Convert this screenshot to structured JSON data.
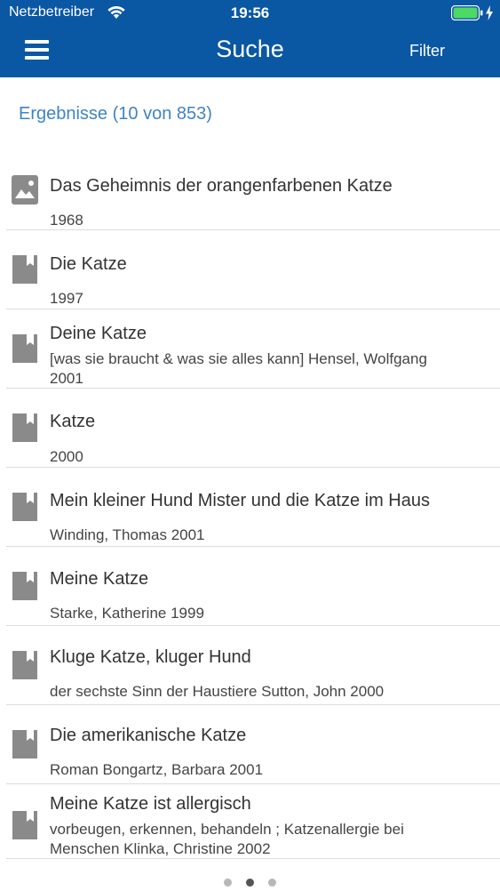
{
  "status": {
    "carrier": "Netzbetreiber",
    "time": "19:56"
  },
  "nav": {
    "title": "Suche",
    "filter_label": "Filter"
  },
  "results_count": "Ergebnisse (10 von 853)",
  "results": [
    {
      "type": "image-icon",
      "title": "Das Geheimnis der orangenfarbenen Katze",
      "sub": "1968"
    },
    {
      "type": "book-icon",
      "title": "Die Katze",
      "sub": "1997"
    },
    {
      "type": "book-icon",
      "title": "Deine Katze",
      "sub": "[was sie braucht & was sie alles kann] Hensel, Wolfgang 2001"
    },
    {
      "type": "book-icon",
      "title": "Katze",
      "sub": "2000"
    },
    {
      "type": "book-icon",
      "title": "Mein kleiner Hund Mister und die Katze im Haus",
      "sub": "Winding, Thomas 2001"
    },
    {
      "type": "book-icon",
      "title": "Meine Katze",
      "sub": "Starke, Katherine 1999"
    },
    {
      "type": "book-icon",
      "title": "Kluge Katze, kluger Hund",
      "sub": "der sechste Sinn der Haustiere Sutton, John 2000"
    },
    {
      "type": "book-icon",
      "title": "Die amerikanische Katze",
      "sub": "Roman Bongartz, Barbara 2001"
    },
    {
      "type": "book-icon",
      "title": "Meine Katze ist allergisch",
      "sub": "vorbeugen, erkennen, behandeln ; Katzenallergie bei Menschen Klinka, Christine 2002"
    }
  ],
  "pager": {
    "page": 2,
    "total": 3
  },
  "colors": {
    "header": "#0a57a4",
    "accent": "#3e84c6",
    "icon": "#8a8a8a"
  }
}
